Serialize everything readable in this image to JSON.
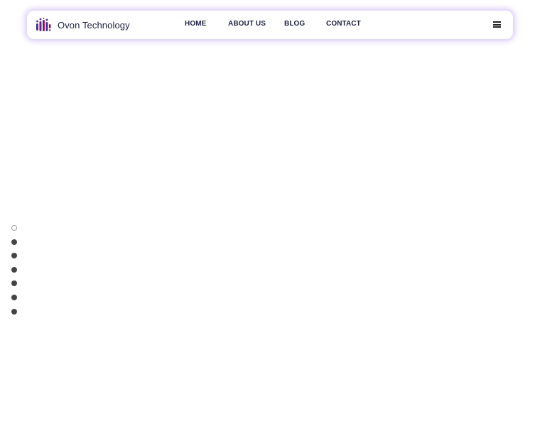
{
  "header": {
    "brand": "Ovon Technology",
    "logo_icon": "bars-logo-icon",
    "nav": [
      {
        "label": "HOME"
      },
      {
        "label": "ABOUT US"
      },
      {
        "label": "BLOG"
      },
      {
        "label": "CONTACT"
      }
    ],
    "menu_icon": "hamburger-icon"
  },
  "pagination": {
    "count": 7,
    "active_index": 0
  },
  "colors": {
    "text": "#1e2140",
    "glow": "#aa8cf0",
    "dot": "#444444"
  }
}
